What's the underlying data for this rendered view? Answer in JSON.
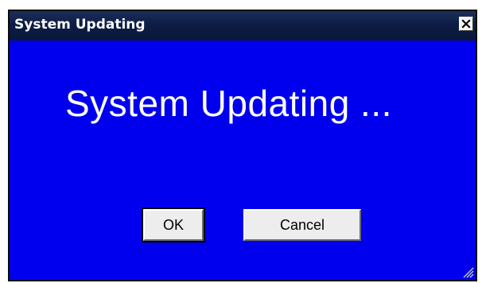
{
  "window": {
    "title": "System Updating",
    "message": "System Updating ...",
    "buttons": {
      "ok_label": "OK",
      "cancel_label": "Cancel"
    },
    "icons": {
      "close": "close-icon",
      "resize": "resize-grip-icon"
    },
    "colors": {
      "background": "#0000ee",
      "titlebar": "#0d1d45",
      "text": "#ffffff"
    }
  }
}
